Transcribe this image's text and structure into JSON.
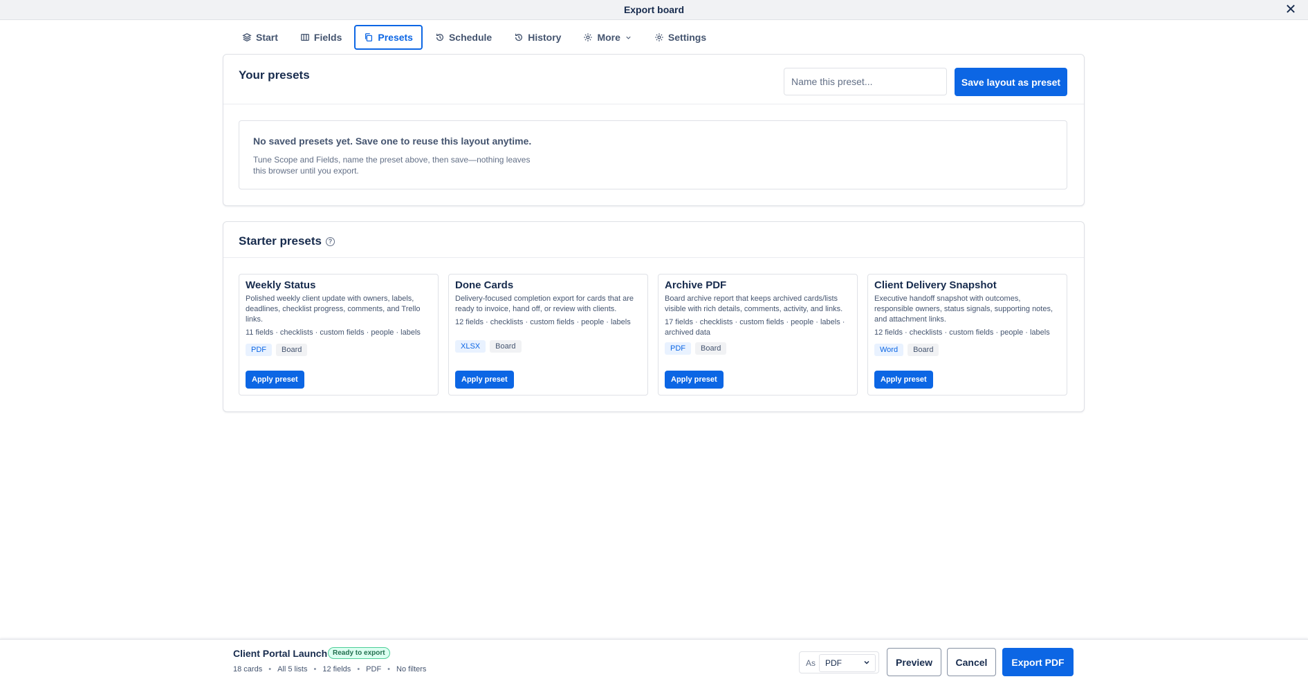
{
  "window": {
    "title": "Export board"
  },
  "tabs": [
    {
      "label": "Start",
      "icon": "layers-icon"
    },
    {
      "label": "Fields",
      "icon": "columns-icon"
    },
    {
      "label": "Presets",
      "icon": "copy-icon",
      "active": true
    },
    {
      "label": "Schedule",
      "icon": "history-icon"
    },
    {
      "label": "History",
      "icon": "history-icon"
    },
    {
      "label": "More",
      "icon": "gear-icon"
    },
    {
      "label": "Settings",
      "icon": "gear-icon"
    }
  ],
  "your_presets": {
    "title": "Your presets",
    "input_placeholder": "Name this preset...",
    "save_label": "Save layout as preset",
    "empty_title": "No saved presets yet. Save one to reuse this layout anytime.",
    "empty_desc": "Tune Scope and Fields, name the preset above, then save—nothing leaves this browser until you export."
  },
  "starter": {
    "title": "Starter presets",
    "items": [
      {
        "name": "Weekly Status",
        "desc": "Polished weekly client update with owners, labels, deadlines, checklist progress, comments, and Trello links.",
        "meta": "11 fields · checklists · custom fields · people · labels",
        "format": "PDF",
        "scope": "Board",
        "apply": "Apply preset"
      },
      {
        "name": "Done Cards",
        "desc": "Delivery-focused completion export for cards that are ready to invoice, hand off, or review with clients.",
        "meta": "12 fields · checklists · custom fields · people · labels",
        "format": "XLSX",
        "scope": "Board",
        "apply": "Apply preset"
      },
      {
        "name": "Archive PDF",
        "desc": "Board archive report that keeps archived cards/lists visible with rich details, comments, activity, and links.",
        "meta": "17 fields · checklists · custom fields · people · labels · archived data",
        "format": "PDF",
        "scope": "Board",
        "apply": "Apply preset"
      },
      {
        "name": "Client Delivery Snapshot",
        "desc": "Executive handoff snapshot with outcomes, responsible owners, status signals, supporting notes, and attachment links.",
        "meta": "12 fields · checklists · custom fields · people · labels",
        "format": "Word",
        "scope": "Board",
        "apply": "Apply preset"
      }
    ]
  },
  "footer": {
    "board_name": "Client Portal Launch",
    "status": "Ready to export",
    "summary": [
      "18 cards",
      "All 5 lists",
      "12 fields",
      "PDF",
      "No filters"
    ],
    "as_label": "As",
    "format_value": "PDF",
    "preview_label": "Preview",
    "cancel_label": "Cancel",
    "export_label": "Export PDF"
  },
  "colors": {
    "accent": "#0c66e4",
    "ready": "#216e4e"
  }
}
